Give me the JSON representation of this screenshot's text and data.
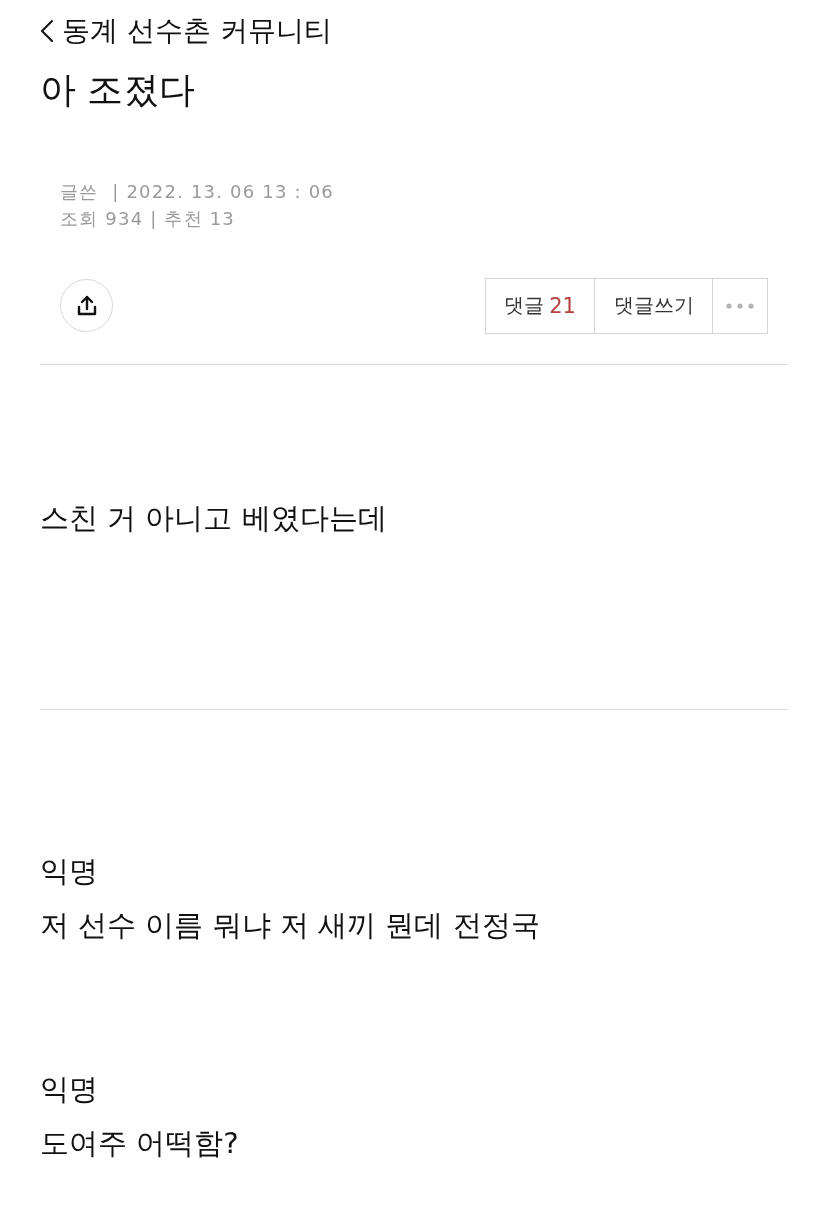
{
  "back_link": {
    "label": "동계 선수촌 커뮤니티"
  },
  "post": {
    "title": "아 조졌다",
    "meta_lines": [
      "글쓴  | 2022. 13. 06 13 : 06",
      "조회 934 | 추천 13"
    ],
    "body": "스친 거 아니고 베였다는데"
  },
  "actions": {
    "comments_button": {
      "label": "댓글",
      "count": "21"
    },
    "write_button": {
      "label": "댓글쓰기"
    }
  },
  "comments": [
    {
      "author": "익명",
      "text": "저 선수 이름 뭐냐 저 새끼 뭔데 전정국"
    },
    {
      "author": "익명",
      "text": "도여주 어떡함?"
    }
  ]
}
